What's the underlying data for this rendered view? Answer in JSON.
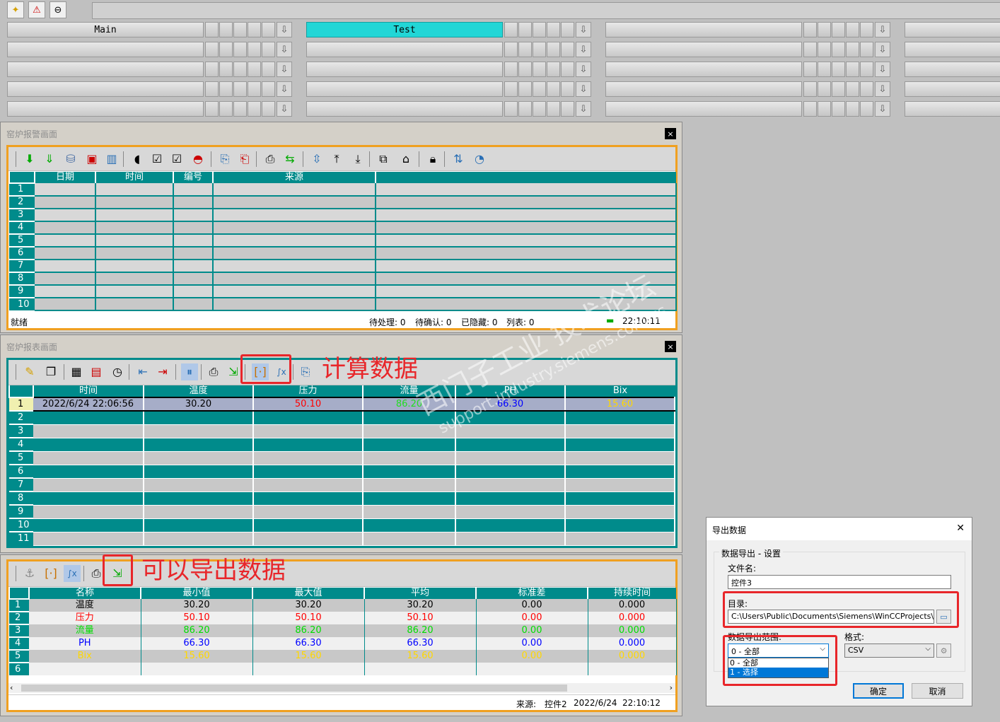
{
  "top_toolbar": {
    "icons": [
      "new-icon",
      "warning-icon",
      "minus-icon"
    ]
  },
  "nav": {
    "row1": [
      "Main",
      "Test",
      "",
      ""
    ],
    "rows": 5
  },
  "alarm_panel": {
    "title": "窑炉报警画面",
    "close": "×",
    "columns": [
      "日期",
      "时间",
      "编号",
      "来源",
      ""
    ],
    "rows": [
      "1",
      "2",
      "3",
      "4",
      "5",
      "6",
      "7",
      "8",
      "9",
      "10"
    ],
    "status": {
      "left": "就绪",
      "pending": "待处理: 0",
      "unack": "待确认: 0",
      "hidden": "已隐藏: 0",
      "list": "列表: 0",
      "time": "22:10:11"
    }
  },
  "report_panel": {
    "title": "窑炉报表画面",
    "close": "×",
    "columns": [
      "时间",
      "温度",
      "压力",
      "流量",
      "PH",
      "Bix"
    ],
    "rows": [
      "1",
      "2",
      "3",
      "4",
      "5",
      "6",
      "7",
      "8",
      "9",
      "10",
      "11"
    ],
    "row1": {
      "time": "2022/6/24 22:06:56",
      "temp": "30.20",
      "pressure": "50.10",
      "flow": "86.20",
      "ph": "66.30",
      "bix": "15.60"
    }
  },
  "stats_panel": {
    "columns": [
      "名称",
      "最小值",
      "最大值",
      "平均",
      "标准差",
      "持续时间"
    ],
    "rows": [
      {
        "n": "1",
        "name": "温度",
        "min": "30.20",
        "max": "30.20",
        "avg": "30.20",
        "std": "0.00",
        "dur": "0.000",
        "color": "#000000"
      },
      {
        "n": "2",
        "name": "压力",
        "min": "50.10",
        "max": "50.10",
        "avg": "50.10",
        "std": "0.00",
        "dur": "0.000",
        "color": "#ff0000"
      },
      {
        "n": "3",
        "name": "流量",
        "min": "86.20",
        "max": "86.20",
        "avg": "86.20",
        "std": "0.00",
        "dur": "0.000",
        "color": "#00dd00"
      },
      {
        "n": "4",
        "name": "PH",
        "min": "66.30",
        "max": "66.30",
        "avg": "66.30",
        "std": "0.00",
        "dur": "0.000",
        "color": "#0000ff"
      },
      {
        "n": "5",
        "name": "Bix",
        "min": "15.60",
        "max": "15.60",
        "avg": "15.60",
        "std": "0.00",
        "dur": "0.000",
        "color": "#ffd700"
      },
      {
        "n": "6",
        "name": "",
        "min": "",
        "max": "",
        "avg": "",
        "std": "",
        "dur": "",
        "color": "#000000"
      }
    ],
    "status": {
      "source_label": "来源:",
      "source": "控件2",
      "date": "2022/6/24",
      "time": "22:10:12"
    }
  },
  "annotations": {
    "calc": "计算数据",
    "export": "可以导出数据"
  },
  "watermark": {
    "line1": "西门子工业 技术论坛",
    "line2": "support.industry.siemens.com/cs"
  },
  "dialog": {
    "title": "导出数据",
    "close": "✕",
    "group": "数据导出 - 设置",
    "filename_label": "文件名:",
    "filename": "控件3",
    "dir_label": "目录:",
    "dir": "C:\\Users\\Public\\Documents\\Siemens\\WinCCProjects\\Color_\\",
    "range_label": "数据导出范围:",
    "range_value": "0 - 全部",
    "range_options": [
      "0 - 全部",
      "1 - 选择"
    ],
    "format_label": "格式:",
    "format_value": "CSV",
    "ok": "确定",
    "cancel": "取消"
  },
  "colors": {
    "teal": "#008b8b",
    "accent": "#f0a020",
    "annotation": "#e8262a",
    "active_nav": "#22d6d6"
  }
}
